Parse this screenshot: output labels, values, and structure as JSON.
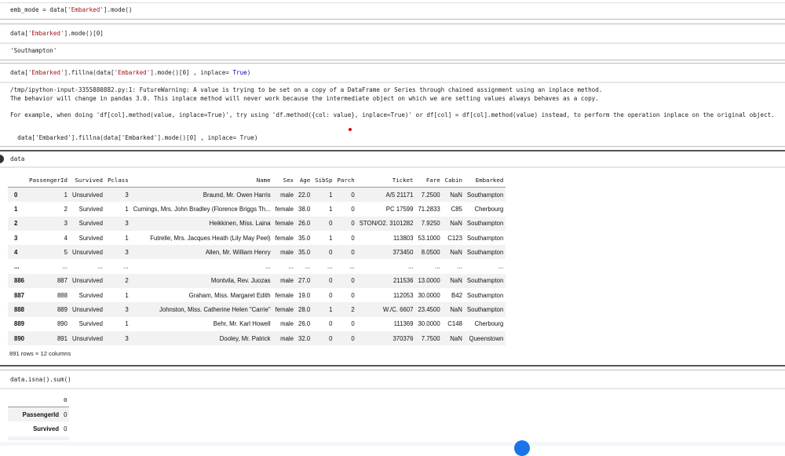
{
  "cells": [
    {
      "code": [
        "emb_mode = data[",
        "'Embarked'",
        "].mode()"
      ]
    },
    {
      "code": [
        "data[",
        "'Embarked'",
        "].mode()[0]"
      ],
      "output": "'Southampton'"
    },
    {
      "code": [
        "data[",
        "'Embarked'",
        "].fillna(data[",
        "'Embarked'",
        "].mode()[0] , inplace= ",
        "True",
        ")"
      ],
      "warning": "/tmp/ipython-input-3355880882.py:1: FutureWarning: A value is trying to be set on a copy of a DataFrame or Series through chained assignment using an inplace method.\nThe behavior will change in pandas 3.0. This inplace method will never work because the intermediate object on which we are setting values always behaves as a copy.\n\nFor example, when doing 'df[col].method(value, inplace=True)', try using 'df.method({col: value}, inplace=True)' or df[col] = df[col].method(value) instead, to perform the operation inplace on the original object.",
      "warning_source": "  data['Embarked'].fillna(data['Embarked'].mode()[0] , inplace= True)"
    },
    {
      "code": "data"
    },
    {
      "code": "data.isna().sum()"
    }
  ],
  "dataframe": {
    "columns": [
      "",
      "PassengerId",
      "Survived",
      "Pclass",
      "Name",
      "Sex",
      "Age",
      "SibSp",
      "Parch",
      "Ticket",
      "Fare",
      "Cabin",
      "Embarked"
    ],
    "rows": [
      [
        "0",
        "1",
        "Unsurvived",
        "3",
        "Braund, Mr. Owen Harris",
        "male",
        "22.0",
        "1",
        "0",
        "A/5 21171",
        "7.2500",
        "NaN",
        "Southampton"
      ],
      [
        "1",
        "2",
        "Survived",
        "1",
        "Cumings, Mrs. John Bradley (Florence Briggs Th...",
        "female",
        "38.0",
        "1",
        "0",
        "PC 17599",
        "71.2833",
        "C85",
        "Cherbourg"
      ],
      [
        "2",
        "3",
        "Survived",
        "3",
        "Heikkinen, Miss. Laina",
        "female",
        "26.0",
        "0",
        "0",
        "STON/O2. 3101282",
        "7.9250",
        "NaN",
        "Southampton"
      ],
      [
        "3",
        "4",
        "Survived",
        "1",
        "Futrelle, Mrs. Jacques Heath (Lily May Peel)",
        "female",
        "35.0",
        "1",
        "0",
        "113803",
        "53.1000",
        "C123",
        "Southampton"
      ],
      [
        "4",
        "5",
        "Unsurvived",
        "3",
        "Allen, Mr. William Henry",
        "male",
        "35.0",
        "0",
        "0",
        "373450",
        "8.0500",
        "NaN",
        "Southampton"
      ],
      [
        "...",
        "...",
        "...",
        "...",
        "...",
        "...",
        "...",
        "...",
        "...",
        "...",
        "...",
        "...",
        "..."
      ],
      [
        "886",
        "887",
        "Unsurvived",
        "2",
        "Montvila, Rev. Juozas",
        "male",
        "27.0",
        "0",
        "0",
        "211536",
        "13.0000",
        "NaN",
        "Southampton"
      ],
      [
        "887",
        "888",
        "Survived",
        "1",
        "Graham, Miss. Margaret Edith",
        "female",
        "19.0",
        "0",
        "0",
        "112053",
        "30.0000",
        "B42",
        "Southampton"
      ],
      [
        "888",
        "889",
        "Unsurvived",
        "3",
        "Johnston, Miss. Catherine Helen \"Carrie\"",
        "female",
        "28.0",
        "1",
        "2",
        "W./C. 6607",
        "23.4500",
        "NaN",
        "Southampton"
      ],
      [
        "889",
        "890",
        "Survived",
        "1",
        "Behr, Mr. Karl Howell",
        "male",
        "26.0",
        "0",
        "0",
        "111369",
        "30.0000",
        "C148",
        "Cherbourg"
      ],
      [
        "890",
        "891",
        "Unsurvived",
        "3",
        "Dooley, Mr. Patrick",
        "male",
        "32.0",
        "0",
        "0",
        "370376",
        "7.7500",
        "NaN",
        "Queenstown"
      ]
    ],
    "shape": "891 rows × 12 columns"
  },
  "isna": {
    "header": "0",
    "rows": [
      [
        "PassengerId",
        "0"
      ],
      [
        "Survived",
        "0"
      ]
    ]
  },
  "colors": {
    "string": "#a31515",
    "keyword": "#0000c8",
    "accent": "#1a73e8"
  }
}
